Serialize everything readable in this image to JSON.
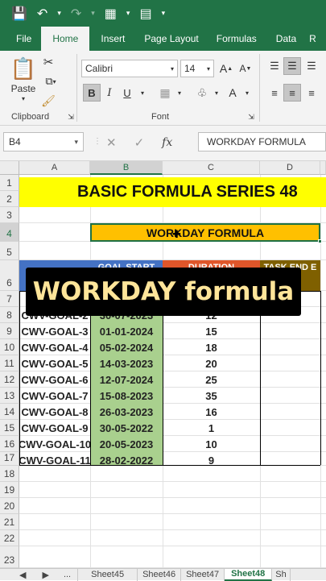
{
  "ribbon_tabs": [
    "File",
    "Home",
    "Insert",
    "Page Layout",
    "Formulas",
    "Data",
    "R"
  ],
  "font": {
    "name": "Calibri",
    "size": "14"
  },
  "group_labels": {
    "clipboard": "Clipboard",
    "font": "Font"
  },
  "paste_label": "Paste",
  "name_box": "B4",
  "formula_text": "WORKDAY FORMULA",
  "columns": [
    "A",
    "B",
    "C",
    "D"
  ],
  "rows": [
    "1",
    "2",
    "3",
    "4",
    "5",
    "6",
    "7",
    "8",
    "9",
    "10",
    "11",
    "12",
    "13",
    "14",
    "15",
    "16",
    "17",
    "18",
    "19",
    "20",
    "21",
    "22",
    "23"
  ],
  "title": "BASIC FORMULA SERIES 48",
  "section_title": "WORKDAY FORMULA",
  "table_headers": {
    "goal_start": "GOAL START",
    "duration": "DURATION",
    "task_end": "TASK END E"
  },
  "table_rows": [
    {
      "goal": "CWV-GOAL-2",
      "date": "30-07-2023",
      "duration": "12"
    },
    {
      "goal": "CWV-GOAL-3",
      "date": "01-01-2024",
      "duration": "15"
    },
    {
      "goal": "CWV-GOAL-4",
      "date": "05-02-2024",
      "duration": "18"
    },
    {
      "goal": "CWV-GOAL-5",
      "date": "14-03-2023",
      "duration": "20"
    },
    {
      "goal": "CWV-GOAL-6",
      "date": "12-07-2024",
      "duration": "25"
    },
    {
      "goal": "CWV-GOAL-7",
      "date": "15-08-2023",
      "duration": "35"
    },
    {
      "goal": "CWV-GOAL-8",
      "date": "26-03-2023",
      "duration": "16"
    },
    {
      "goal": "CWV-GOAL-9",
      "date": "30-05-2022",
      "duration": "1"
    },
    {
      "goal": "CWV-GOAL-10",
      "date": "20-05-2023",
      "duration": "10"
    },
    {
      "goal": "CWV-GOAL-11",
      "date": "28-02-2022",
      "duration": "9"
    }
  ],
  "overlay_caption": "WORKDAY formula",
  "sheet_tabs": [
    "Sheet45",
    "Sheet46",
    "Sheet47",
    "Sheet48",
    "Sh"
  ],
  "sheet_nav": {
    "ellipsis": "..."
  },
  "colors": {
    "excel_green": "#217346",
    "title_yellow": "#ffff00",
    "section_orange": "#ffc000",
    "goal_start_blue": "#4472c4",
    "duration_red": "#e0562a",
    "task_end_brown": "#7f6000",
    "date_green": "#a9d08e"
  }
}
